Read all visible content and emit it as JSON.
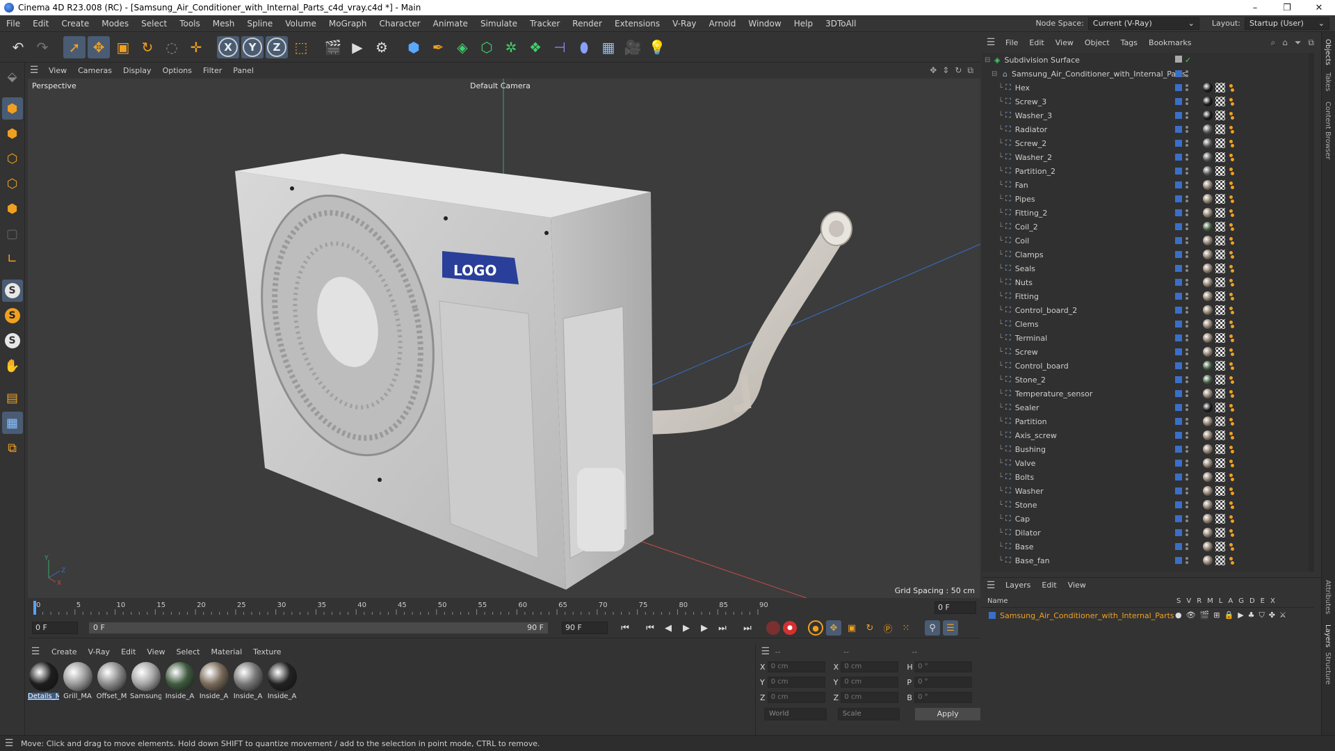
{
  "window": {
    "title": "Cinema 4D R23.008 (RC) - [Samsung_Air_Conditioner_with_Internal_Parts_c4d_vray.c4d *] - Main",
    "controls": [
      "–",
      "❐",
      "✕"
    ]
  },
  "menu": {
    "items": [
      "File",
      "Edit",
      "Create",
      "Modes",
      "Select",
      "Tools",
      "Mesh",
      "Spline",
      "Volume",
      "MoGraph",
      "Character",
      "Animate",
      "Simulate",
      "Tracker",
      "Render",
      "Extensions",
      "V-Ray",
      "Arnold",
      "Window",
      "Help",
      "3DToAll"
    ],
    "node_space_label": "Node Space:",
    "node_space_value": "Current (V-Ray)",
    "layout_label": "Layout:",
    "layout_value": "Startup (User)"
  },
  "toolbar": {
    "axis_x": "X",
    "axis_y": "Y",
    "axis_z": "Z"
  },
  "left_tools": {
    "s1": "S",
    "s2": "S",
    "s3": "S"
  },
  "viewport": {
    "menu": [
      "View",
      "Cameras",
      "Display",
      "Options",
      "Filter",
      "Panel"
    ],
    "view_name": "Perspective",
    "camera": "Default Camera",
    "grid_spacing": "Grid Spacing : 50 cm",
    "axis_y": "Y",
    "axis_z": "Z",
    "axis_x": "X",
    "logo": "LOGO"
  },
  "timeline": {
    "ticks": [
      "0",
      "5",
      "10",
      "15",
      "20",
      "25",
      "30",
      "35",
      "40",
      "45",
      "50",
      "55",
      "60",
      "65",
      "70",
      "75",
      "80",
      "85",
      "90"
    ],
    "current_frame": "0 F",
    "start_field": "0 F",
    "range_start": "0 F",
    "range_end": "90 F",
    "end_field": "90 F"
  },
  "materials": {
    "menu": [
      "Create",
      "V-Ray",
      "Edit",
      "View",
      "Select",
      "Material",
      "Texture"
    ],
    "items": [
      {
        "name": "Details_M",
        "color": "#1d1d1d",
        "selected": true
      },
      {
        "name": "Grill_MA",
        "color": "#9a9a9a",
        "selected": false
      },
      {
        "name": "Offset_M",
        "color": "#8a8a8a",
        "selected": false
      },
      {
        "name": "Samsung",
        "color": "#a5a5a5",
        "selected": false
      },
      {
        "name": "Inside_A",
        "color": "#3f5a3f",
        "selected": false
      },
      {
        "name": "Inside_A",
        "color": "#7a6a5a",
        "selected": false
      },
      {
        "name": "Inside_A",
        "color": "#777777",
        "selected": false
      },
      {
        "name": "Inside_A",
        "color": "#222222",
        "selected": false
      }
    ]
  },
  "coords": {
    "headers": [
      "--",
      "--",
      "--"
    ],
    "rows": [
      {
        "a": "X",
        "v1": "0 cm",
        "b": "X",
        "v2": "0 cm",
        "c": "H",
        "v3": "0 °"
      },
      {
        "a": "Y",
        "v1": "0 cm",
        "b": "Y",
        "v2": "0 cm",
        "c": "P",
        "v3": "0 °"
      },
      {
        "a": "Z",
        "v1": "0 cm",
        "b": "Z",
        "v2": "0 cm",
        "c": "B",
        "v3": "0 °"
      }
    ],
    "space": "World",
    "mode": "Scale",
    "apply": "Apply"
  },
  "status": {
    "message": "Move: Click and drag to move elements. Hold down SHIFT to quantize movement / add to the selection in point mode, CTRL to remove."
  },
  "object_manager": {
    "menu": [
      "File",
      "Edit",
      "View",
      "Object",
      "Tags",
      "Bookmarks"
    ],
    "root": "Subdivision Surface",
    "group": "Samsung_Air_Conditioner_with_Internal_Parts",
    "objects": [
      {
        "name": "Hex",
        "mat": "#1a1a1a"
      },
      {
        "name": "Screw_3",
        "mat": "#1a1a1a"
      },
      {
        "name": "Washer_3",
        "mat": "#1a1a1a"
      },
      {
        "name": "Radiator",
        "mat": "#555555"
      },
      {
        "name": "Screw_2",
        "mat": "#555555"
      },
      {
        "name": "Washer_2",
        "mat": "#555555"
      },
      {
        "name": "Partition_2",
        "mat": "#555555"
      },
      {
        "name": "Fan",
        "mat": "#8a7a6a"
      },
      {
        "name": "Pipes",
        "mat": "#8a7a6a"
      },
      {
        "name": "Fitting_2",
        "mat": "#8a7a6a"
      },
      {
        "name": "Coil_2",
        "mat": "#3f5a3f"
      },
      {
        "name": "Coil",
        "mat": "#8a7a6a"
      },
      {
        "name": "Clamps",
        "mat": "#8a7a6a"
      },
      {
        "name": "Seals",
        "mat": "#8a7a6a"
      },
      {
        "name": "Nuts",
        "mat": "#8a7a6a"
      },
      {
        "name": "Fitting",
        "mat": "#8a7a6a"
      },
      {
        "name": "Control_board_2",
        "mat": "#8a7a6a"
      },
      {
        "name": "Clems",
        "mat": "#8a7a6a"
      },
      {
        "name": "Terminal",
        "mat": "#8a7a6a"
      },
      {
        "name": "Screw",
        "mat": "#8a7a6a"
      },
      {
        "name": "Control_board",
        "mat": "#3f5a3f"
      },
      {
        "name": "Stone_2",
        "mat": "#3f5a3f"
      },
      {
        "name": "Temperature_sensor",
        "mat": "#8a7a6a"
      },
      {
        "name": "Sealer",
        "mat": "#1a1a1a"
      },
      {
        "name": "Partition",
        "mat": "#8a7a6a"
      },
      {
        "name": "Axis_screw",
        "mat": "#8a7a6a"
      },
      {
        "name": "Bushing",
        "mat": "#8a7a6a"
      },
      {
        "name": "Valve",
        "mat": "#8a7a6a"
      },
      {
        "name": "Bolts",
        "mat": "#8a7a6a"
      },
      {
        "name": "Washer",
        "mat": "#8a7a6a"
      },
      {
        "name": "Stone",
        "mat": "#8a7a6a"
      },
      {
        "name": "Cap",
        "mat": "#8a7a6a"
      },
      {
        "name": "Dilator",
        "mat": "#8a7a6a"
      },
      {
        "name": "Base",
        "mat": "#8a7a6a"
      },
      {
        "name": "Base_fan",
        "mat": "#8a7a6a"
      }
    ]
  },
  "layers": {
    "menu": [
      "Layers",
      "Edit",
      "View"
    ],
    "header_name": "Name",
    "columns": [
      "S",
      "V",
      "R",
      "M",
      "L",
      "A",
      "G",
      "D",
      "E",
      "X"
    ],
    "layer_name": "Samsung_Air_Conditioner_with_Internal_Parts"
  },
  "side_tabs": [
    "Objects",
    "Takes",
    "Content Browser",
    "Attributes",
    "Layers",
    "Structure"
  ]
}
